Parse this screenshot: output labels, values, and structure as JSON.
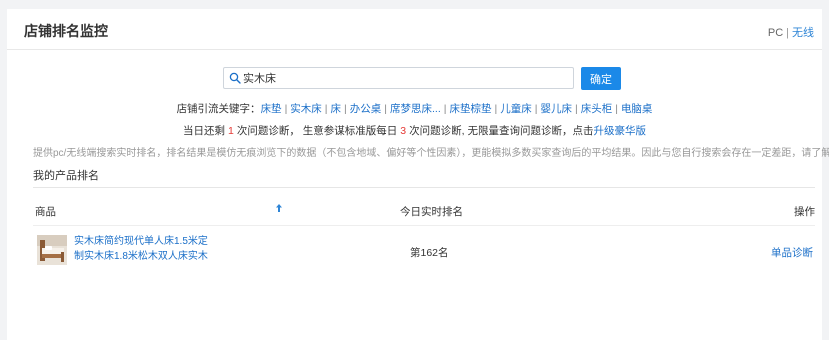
{
  "header": {
    "title": "店铺排名监控",
    "platform_pc": "PC",
    "platform_sep": "|",
    "platform_wireless": "无线"
  },
  "search": {
    "value": "实木床",
    "placeholder": "",
    "confirm_label": "确定"
  },
  "keywords": {
    "prefix": "店铺引流关键字：",
    "items": [
      "床垫",
      "实木床",
      "床",
      "办公桌",
      "席梦思床...",
      "床垫棕垫",
      "儿童床",
      "婴儿床",
      "床头柜",
      "电脑桌"
    ],
    "separator": "|"
  },
  "quota": {
    "part1": "当日还剩",
    "remaining": "1",
    "part2": "次问题诊断，  生意参谋标准版每日",
    "daily": "3",
    "part3": "次问题诊断, 无限量查询问题诊断，点击",
    "upgrade_link": "升级豪华版"
  },
  "disclaimer": "提供pc/无线端搜索实时排名，排名结果是模仿无痕浏览下的数据（不包含地域、偏好等个性因素），更能模拟多数买家查询后的平均结果。因此与您自行搜索会存在一定差距，请了解。",
  "section_title": "我的产品排名",
  "table": {
    "col_product": "商品",
    "col_rank": "今日实时排名",
    "col_action": "操作",
    "rows": [
      {
        "title_line1": "实木床简约现代单人床1.5米定",
        "title_line2": "制实木床1.8米松木双人床实木",
        "rank": "第162名",
        "action": "单品诊断"
      }
    ]
  },
  "colors": {
    "accent": "#1b89e8",
    "link": "#1b6fc8",
    "highlight": "#e53935",
    "muted": "#999999"
  }
}
